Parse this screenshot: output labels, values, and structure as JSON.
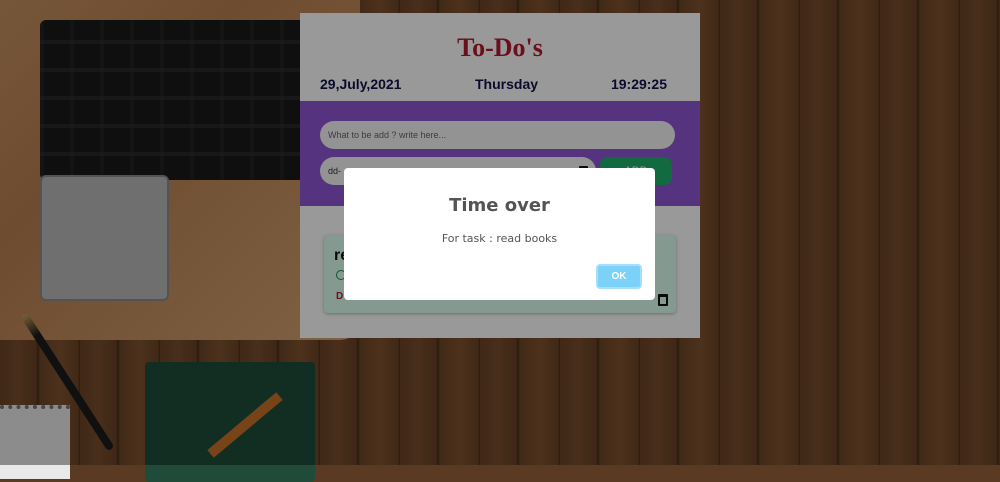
{
  "app": {
    "title": "To-Do's",
    "date": "29,July,2021",
    "weekday": "Thursday",
    "time": "19:29:25",
    "task_input": {
      "placeholder": "What to be add ? write here..."
    },
    "date_input": {
      "value": "dd-"
    },
    "add_label": "ADD"
  },
  "task": {
    "name_visible": "re",
    "deadline_visible": "D"
  },
  "modal": {
    "title": "Time over",
    "message": "For task : read books",
    "ok_label": "OK"
  },
  "colors": {
    "title": "#b41a2f",
    "panel": "#8e55d4",
    "add_button": "#1fb36b",
    "ok_button": "#7cd1f9"
  }
}
